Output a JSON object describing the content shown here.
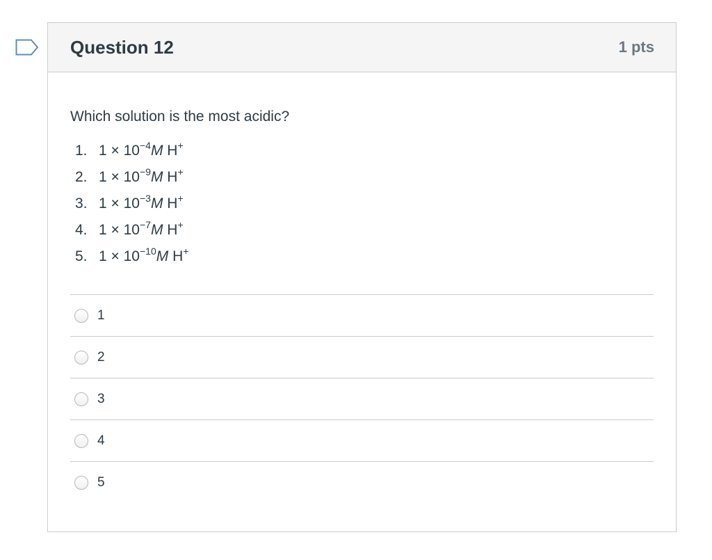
{
  "question": {
    "title": "Question 12",
    "points": "1 pts",
    "text": "Which solution is the most acidic?",
    "options": [
      {
        "num": "1.",
        "coef": "1 × 10",
        "exp": "−4",
        "unit": "M",
        "ion": " H",
        "charge": "+"
      },
      {
        "num": "2.",
        "coef": "1 × 10",
        "exp": "−9",
        "unit": "M",
        "ion": " H",
        "charge": "+"
      },
      {
        "num": "3.",
        "coef": "1 × 10",
        "exp": "−3",
        "unit": "M",
        "ion": " H",
        "charge": "+"
      },
      {
        "num": "4.",
        "coef": "1 × 10",
        "exp": "−7",
        "unit": "M",
        "ion": " H",
        "charge": "+"
      },
      {
        "num": "5.",
        "coef": "1 × 10",
        "exp": "−10",
        "unit": "M",
        "ion": " H",
        "charge": "+"
      }
    ],
    "answers": [
      {
        "label": "1"
      },
      {
        "label": "2"
      },
      {
        "label": "3"
      },
      {
        "label": "4"
      },
      {
        "label": "5"
      }
    ]
  },
  "icons": {
    "flag": "bookmark-flag-icon",
    "radio": "radio-unchecked-icon"
  },
  "colors": {
    "header_bg": "#f5f5f5",
    "border": "#c7cdd1",
    "text": "#2d3b45",
    "points": "#6b7780",
    "flag": "#5b8ec4"
  }
}
